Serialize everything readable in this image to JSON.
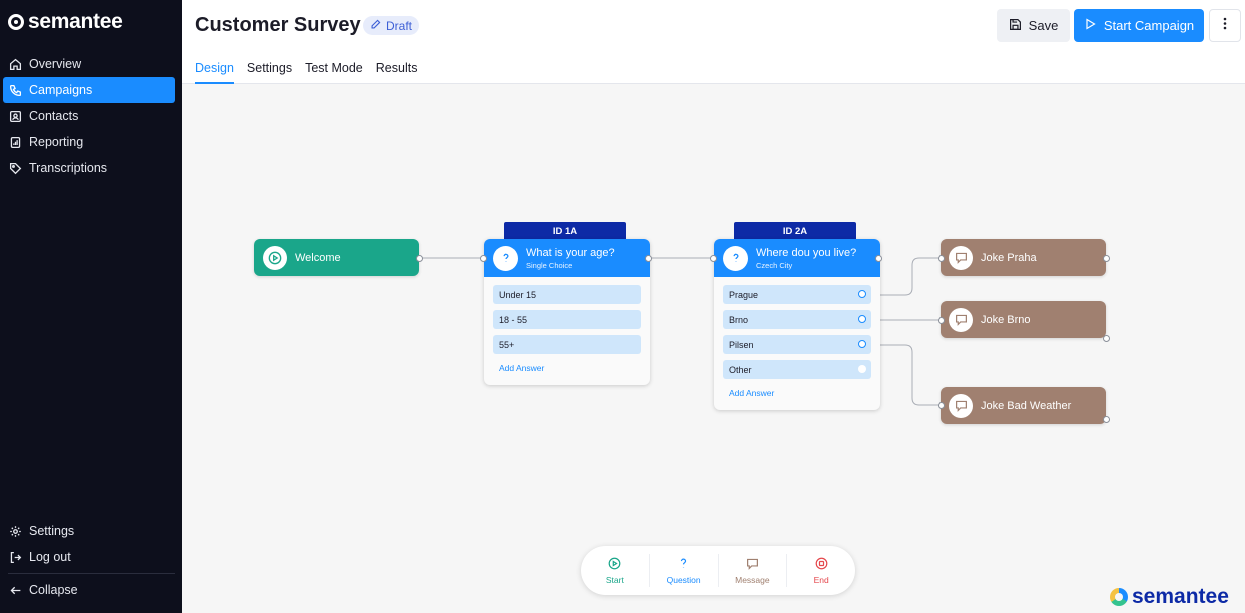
{
  "app": {
    "logo_text": "semantee",
    "brand_text": "semantee"
  },
  "sidebar": {
    "items": [
      {
        "label": "Overview",
        "icon": "home-icon"
      },
      {
        "label": "Campaigns",
        "icon": "phone-icon",
        "active": true
      },
      {
        "label": "Contacts",
        "icon": "contact-card-icon"
      },
      {
        "label": "Reporting",
        "icon": "report-icon"
      },
      {
        "label": "Transcriptions",
        "icon": "tag-icon"
      }
    ],
    "bottom": [
      {
        "label": "Settings",
        "icon": "gear-icon"
      },
      {
        "label": "Log out",
        "icon": "logout-icon"
      }
    ],
    "collapse_label": "Collapse"
  },
  "header": {
    "title": "Customer Survey",
    "status": "Draft",
    "save_label": "Save",
    "start_label": "Start Campaign",
    "tabs": [
      "Design",
      "Settings",
      "Test Mode",
      "Results"
    ],
    "active_tab": "Design"
  },
  "flow": {
    "start": {
      "label": "Welcome"
    },
    "questions": [
      {
        "id": "ID 1A",
        "title": "What is your age?",
        "subtitle": "Single Choice",
        "answers": [
          "Under 15",
          "18 - 55",
          "55+"
        ],
        "add_label": "Add Answer"
      },
      {
        "id": "ID 2A",
        "title": "Where dou you live?",
        "subtitle": "Czech City",
        "answers": [
          "Prague",
          "Brno",
          "Pilsen",
          "Other"
        ],
        "add_label": "Add Answer"
      }
    ],
    "messages": [
      {
        "label": "Joke Praha"
      },
      {
        "label": "Joke Brno"
      },
      {
        "label": "Joke Bad Weather"
      }
    ]
  },
  "toolbar": {
    "items": [
      {
        "label": "Start",
        "icon": "play-icon",
        "color": "#1aa68a"
      },
      {
        "label": "Question",
        "icon": "question-icon",
        "color": "#1a8cff"
      },
      {
        "label": "Message",
        "icon": "message-icon",
        "color": "#a08070"
      },
      {
        "label": "End",
        "icon": "stop-icon",
        "color": "#e5484d"
      }
    ]
  },
  "colors": {
    "accent": "#1a8cff",
    "start": "#1aa68a",
    "message": "#a08070",
    "id_badge": "#0d2aa6"
  }
}
